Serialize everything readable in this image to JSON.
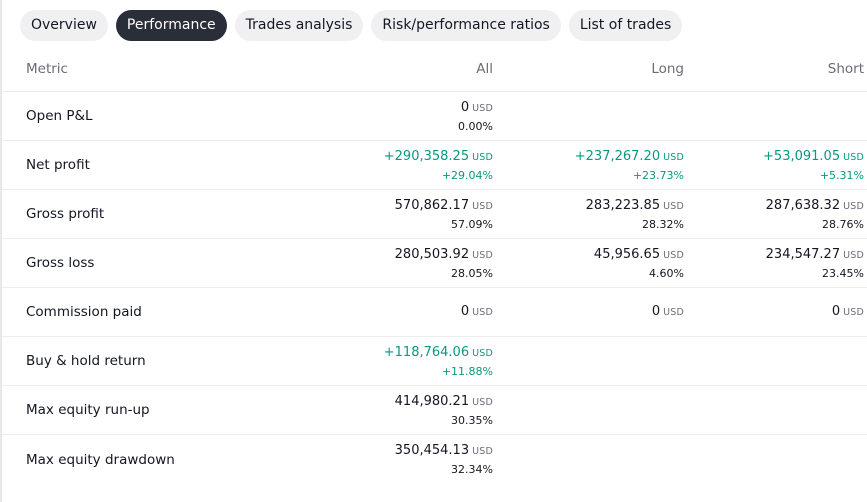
{
  "tabs": [
    {
      "label": "Overview",
      "active": false
    },
    {
      "label": "Performance",
      "active": true
    },
    {
      "label": "Trades analysis",
      "active": false
    },
    {
      "label": "Risk/performance ratios",
      "active": false
    },
    {
      "label": "List of trades",
      "active": false
    }
  ],
  "table": {
    "headers": {
      "metric": "Metric",
      "all": "All",
      "long": "Long",
      "short": "Short"
    },
    "unit": "USD",
    "colors": {
      "positive": "#089981",
      "neutral": "#131722",
      "muted": "#6a6d78"
    },
    "rows": [
      {
        "metric": "Open P&L",
        "all": {
          "value": "0",
          "unit": "USD",
          "pct": "0.00%",
          "positive": false
        },
        "long": null,
        "short": null
      },
      {
        "metric": "Net profit",
        "all": {
          "value": "+290,358.25",
          "unit": "USD",
          "pct": "+29.04%",
          "positive": true
        },
        "long": {
          "value": "+237,267.20",
          "unit": "USD",
          "pct": "+23.73%",
          "positive": true
        },
        "short": {
          "value": "+53,091.05",
          "unit": "USD",
          "pct": "+5.31%",
          "positive": true
        }
      },
      {
        "metric": "Gross profit",
        "all": {
          "value": "570,862.17",
          "unit": "USD",
          "pct": "57.09%",
          "positive": false
        },
        "long": {
          "value": "283,223.85",
          "unit": "USD",
          "pct": "28.32%",
          "positive": false
        },
        "short": {
          "value": "287,638.32",
          "unit": "USD",
          "pct": "28.76%",
          "positive": false
        }
      },
      {
        "metric": "Gross loss",
        "all": {
          "value": "280,503.92",
          "unit": "USD",
          "pct": "28.05%",
          "positive": false
        },
        "long": {
          "value": "45,956.65",
          "unit": "USD",
          "pct": "4.60%",
          "positive": false
        },
        "short": {
          "value": "234,547.27",
          "unit": "USD",
          "pct": "23.45%",
          "positive": false
        }
      },
      {
        "metric": "Commission paid",
        "all": {
          "value": "0",
          "unit": "USD",
          "pct": "",
          "positive": false
        },
        "long": {
          "value": "0",
          "unit": "USD",
          "pct": "",
          "positive": false
        },
        "short": {
          "value": "0",
          "unit": "USD",
          "pct": "",
          "positive": false
        }
      },
      {
        "metric": "Buy & hold return",
        "all": {
          "value": "+118,764.06",
          "unit": "USD",
          "pct": "+11.88%",
          "positive": true
        },
        "long": null,
        "short": null
      },
      {
        "metric": "Max equity run-up",
        "all": {
          "value": "414,980.21",
          "unit": "USD",
          "pct": "30.35%",
          "positive": false
        },
        "long": null,
        "short": null
      },
      {
        "metric": "Max equity drawdown",
        "all": {
          "value": "350,454.13",
          "unit": "USD",
          "pct": "32.34%",
          "positive": false
        },
        "long": null,
        "short": null
      }
    ]
  }
}
